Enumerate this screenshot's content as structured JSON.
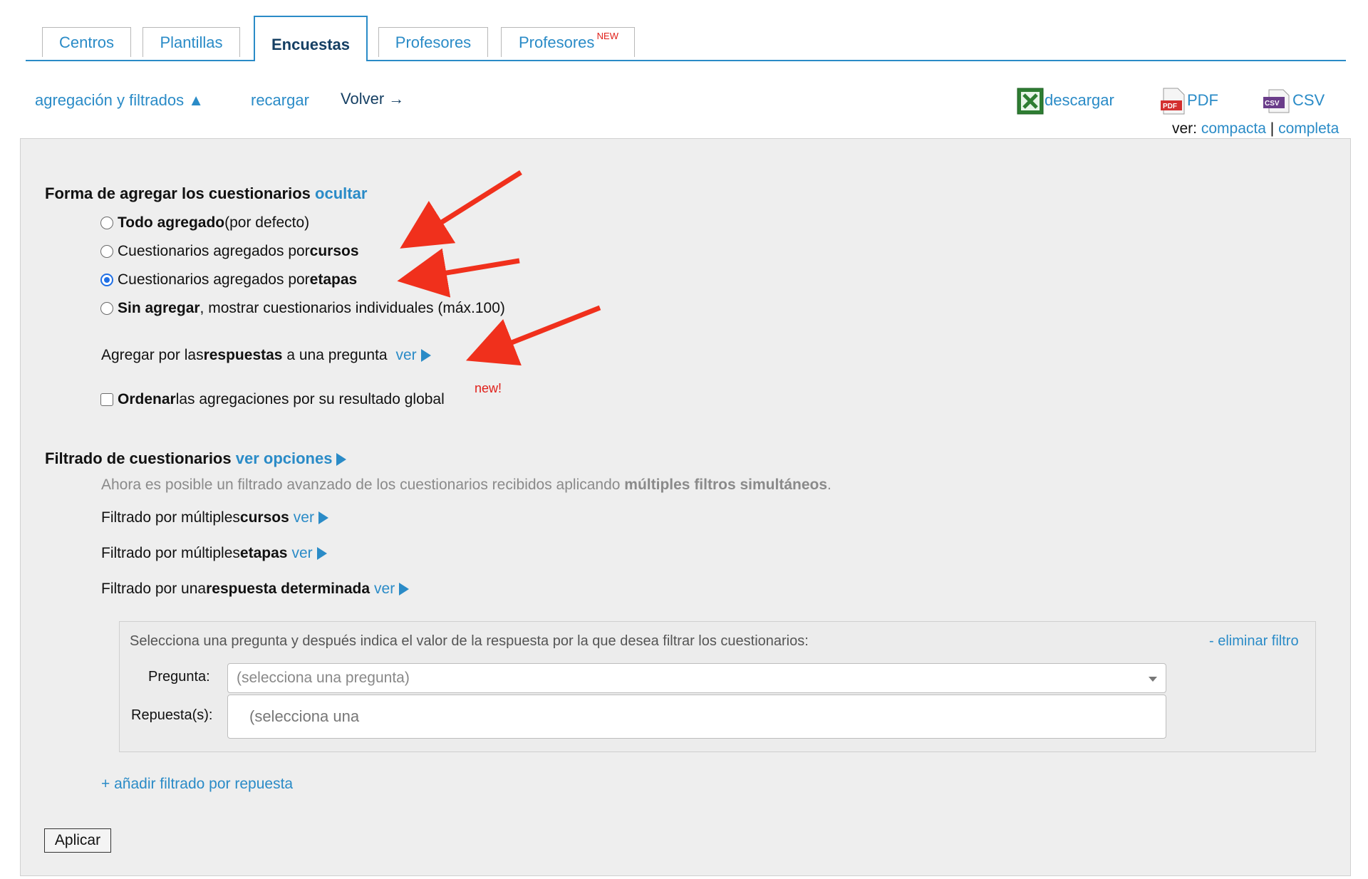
{
  "tabs": [
    {
      "label": "Centros"
    },
    {
      "label": "Plantillas"
    },
    {
      "label": "Encuestas"
    },
    {
      "label": "Profesores"
    },
    {
      "label": "Profesores",
      "badge": "NEW"
    }
  ],
  "toolbar": {
    "aggregation_label": "agregación y filtrados ▲",
    "reload_label": "recargar",
    "back_label": "Volver →",
    "download_label": "descargar",
    "pdf_label": "PDF",
    "csv_label": "CSV",
    "view_prefix": "ver:",
    "view_compact": "compacta",
    "view_separator": "|",
    "view_full": "completa"
  },
  "aggregation": {
    "title": "Forma de agregar los cuestionarios",
    "hide_link": "ocultar",
    "options": [
      {
        "bold": "Todo agregado",
        "rest": " (por defecto)",
        "selected": false
      },
      {
        "pre": "Cuestionarios agregados por ",
        "bold": "cursos",
        "selected": false
      },
      {
        "pre": "Cuestionarios agregados por ",
        "bold": "etapas",
        "selected": true
      },
      {
        "bold": "Sin agregar",
        "rest": ", mostrar cuestionarios individuales (máx.100)",
        "selected": false
      }
    ],
    "by_answer": {
      "pre": "Agregar por las ",
      "bold": "respuestas",
      "rest": " a una pregunta ",
      "link": "ver"
    },
    "order": {
      "bold": "Ordenar",
      "rest": " las agregaciones por su resultado global",
      "badge": "new!",
      "checked": false
    }
  },
  "filtering": {
    "title": "Filtrado de cuestionarios",
    "options_link": "ver opciones",
    "info_pre": "Ahora es posible un filtrado avanzado de los cuestionarios recibidos aplicando ",
    "info_bold": "múltiples filtros simultáneos",
    "info_post": ".",
    "items": [
      {
        "pre": "Filtrado por múltiples ",
        "bold": "cursos",
        "link": "ver"
      },
      {
        "pre": "Filtrado por múltiples ",
        "bold": "etapas",
        "link": "ver"
      },
      {
        "pre": "Filtrado por una ",
        "bold": "respuesta determinada",
        "link": "ver"
      }
    ],
    "box": {
      "instruction": "Selecciona una pregunta y después indica el valor de la respuesta por la que desea filtrar los cuestionarios:",
      "remove_link": "- eliminar filtro",
      "question_label": "Pregunta:",
      "question_placeholder": "(selecciona una pregunta)",
      "answers_label": "Repuesta(s):",
      "answers_placeholder": "(selecciona una"
    },
    "add_link": "+ añadir filtrado por repuesta"
  },
  "apply_label": "Aplicar",
  "colors": {
    "accent": "#2a8bc7",
    "annotation_arrow": "#f0301c",
    "panel_bg": "#eeeeee"
  }
}
